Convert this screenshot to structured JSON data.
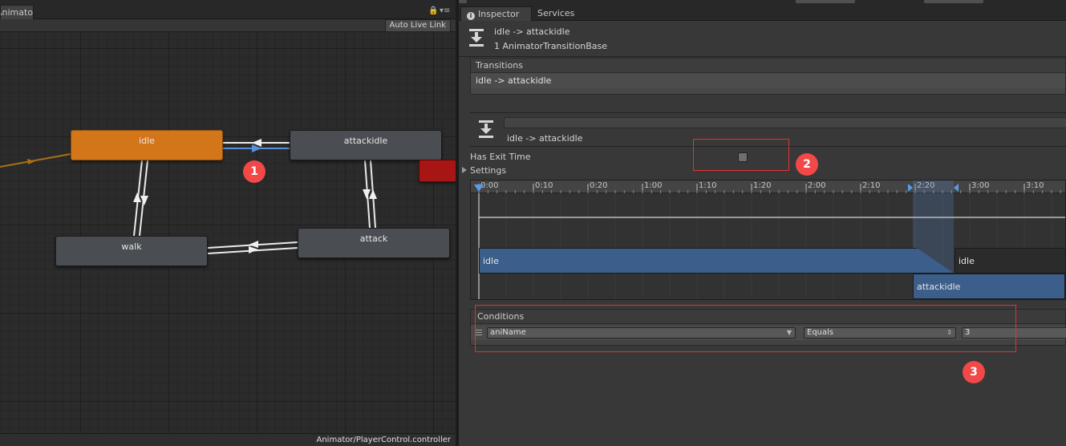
{
  "animator": {
    "tab_label": "Animator",
    "auto_live_link_label": "Auto Live Link",
    "footer_path": "Animator/PlayerControl.controller",
    "states": {
      "idle": "idle",
      "attackidle": "attackidle",
      "walk": "walk",
      "attack": "attack"
    },
    "lock_glyph": "🔒",
    "menu_glyph": "▾≡"
  },
  "badges": {
    "b1": "1",
    "b2": "2",
    "b3": "3"
  },
  "inspector": {
    "tabs": {
      "inspector": "Inspector",
      "services": "Services"
    },
    "header_title": "idle -> attackidle",
    "header_subtitle": "1 AnimatorTransitionBase",
    "transitions_label": "Transitions",
    "transition_item": "idle -> attackidle",
    "sub_title": "idle -> attackidle",
    "has_exit_time_label": "Has Exit Time",
    "has_exit_time": false,
    "settings_label": "Settings",
    "timeline": {
      "ticks": [
        "0:00",
        "0:10",
        "0:20",
        "1:00",
        "1:10",
        "1:20",
        "2:00",
        "2:10",
        "2:20",
        "3:00",
        "3:10"
      ],
      "clip_source": "idle",
      "clip_source_after": "idle",
      "clip_dest": "attackidle"
    },
    "conditions_label": "Conditions",
    "condition": {
      "parameter": "aniName",
      "mode": "Equals",
      "value": "3"
    }
  },
  "colors": {
    "default_state": "#d3761a",
    "red_state": "#a81515",
    "selected_transition": "#5b8fd6",
    "annotation_red": "#e23232",
    "badge": "#f24848"
  }
}
